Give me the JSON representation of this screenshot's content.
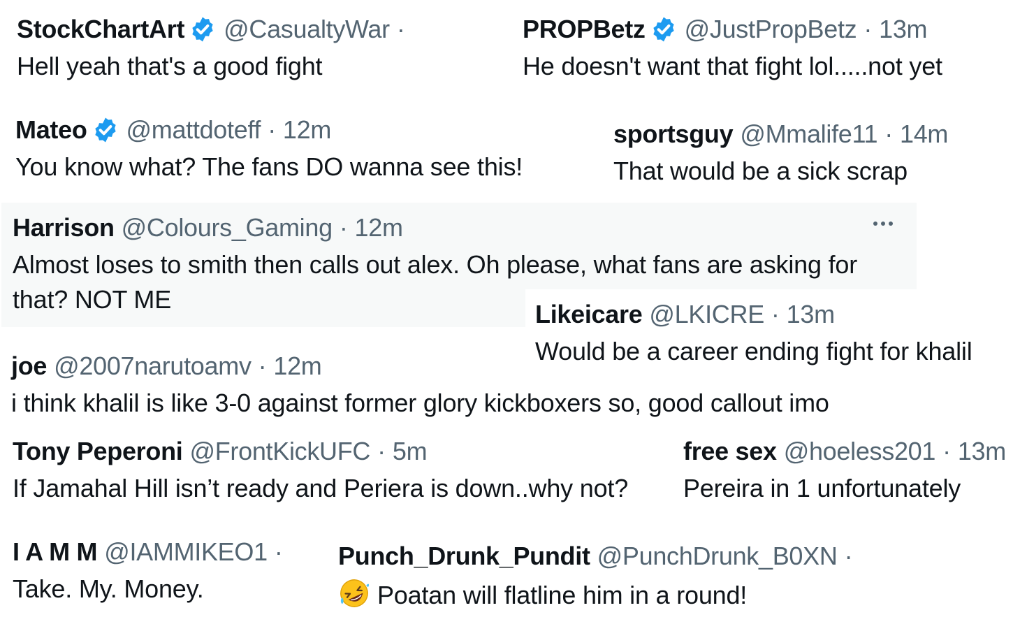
{
  "tweets": [
    {
      "name": "StockChartArt",
      "handle": "@CasualtyWar",
      "time": "",
      "text": "Hell yeah that's a good fight",
      "verified": true
    },
    {
      "name": "PROPBetz",
      "handle": "@JustPropBetz",
      "time": "13m",
      "text": "He doesn't want that fight lol.....not yet",
      "verified": true
    },
    {
      "name": "Mateo",
      "handle": "@mattdoteff",
      "time": "12m",
      "text": "You know what? The fans DO wanna see this!",
      "verified": true
    },
    {
      "name": "sportsguy",
      "handle": "@Mmalife11",
      "time": "14m",
      "text": "That would be a sick scrap",
      "verified": false
    },
    {
      "name": "Harrison",
      "handle": "@Colours_Gaming",
      "time": "12m",
      "text": "Almost loses to smith then calls out alex. Oh please, what fans are asking for that? NOT ME",
      "verified": false
    },
    {
      "name": "Likeicare",
      "handle": "@LKICRE",
      "time": "13m",
      "text": "Would be a career ending fight for khalil",
      "verified": false
    },
    {
      "name": "joe",
      "handle": "@2007narutoamv",
      "time": "12m",
      "text": "i think khalil is like 3-0 against former glory kickboxers so, good callout imo",
      "verified": false
    },
    {
      "name": "Tony Peperoni",
      "handle": "@FrontKickUFC",
      "time": "5m",
      "text": "If Jamahal Hill isn’t ready and Periera is down..why not?",
      "verified": false
    },
    {
      "name": "free sex",
      "handle": "@hoeless201",
      "time": "13m",
      "text": "Pereira in 1 unfortunately",
      "verified": false
    },
    {
      "name": "I A M M",
      "handle": "@IAMMIKEO1",
      "time": "",
      "text": "Take. My. Money.",
      "verified": false
    },
    {
      "name": "Punch_Drunk_Pundit",
      "handle": "@PunchDrunk_B0XN",
      "time": "",
      "text": "Poatan will flatline him in a round!",
      "emoji": "rolling-on-the-floor-laughing-emoji",
      "verified": false
    }
  ],
  "colors": {
    "verified_badge": "#1d9bf0",
    "secondary_text": "#536471",
    "primary_text": "#0f1419",
    "highlight_bg": "#f7f9f9"
  }
}
